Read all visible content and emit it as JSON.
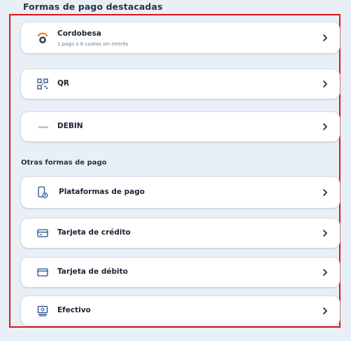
{
  "featured": {
    "title": "Formas de pago destacadas",
    "items": [
      {
        "label": "Cordobesa",
        "subtitle": "1 pago o 6 cuotas sin interés",
        "icon": "cordobesa-logo"
      },
      {
        "label": "QR",
        "icon": "qr-code-icon"
      },
      {
        "label": "DEBIN",
        "icon": "debin-logo",
        "logo_text": "DEBIN"
      }
    ]
  },
  "other": {
    "title": "Otras formas de pago",
    "items": [
      {
        "label": "Plataformas de pago",
        "icon": "mobile-payment-icon"
      },
      {
        "label": "Tarjeta de crédito",
        "icon": "credit-card-icon"
      },
      {
        "label": "Tarjeta de débito",
        "icon": "debit-card-icon"
      },
      {
        "label": "Efectivo",
        "icon": "cash-icon"
      }
    ]
  },
  "colors": {
    "background": "#e9eff6",
    "highlight_border": "#e0141b",
    "icon_blue": "#1f4c8c",
    "cordobesa_orange": "#f07c1e",
    "cordobesa_dark": "#1b3d4a"
  }
}
